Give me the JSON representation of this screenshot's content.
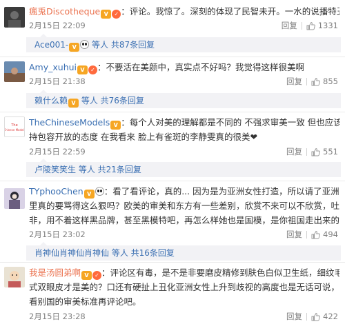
{
  "comments": [
    {
      "user": "瘋兎Discotheque",
      "text": "：评论。我惊了。深刻的体现了民智未开。一水的说播特丑。品品。",
      "lines": [
        "：评论。我惊了。深刻的体现了民智未开。一水的说播特丑。品品。"
      ],
      "time": "2月15日 22:09",
      "reply_label": "回复",
      "likes": "1331",
      "replies": {
        "user": "Ace001-",
        "summary": "等人 共87条回复"
      }
    },
    {
      "user": "Amy_xuhui",
      "lines": [
        "：不要活在美颜中，真实点不好吗？我觉得这样很美啊"
      ],
      "time": "2月15日 21:38",
      "reply_label": "回复",
      "likes": "855",
      "replies": {
        "user": "赖什么赖",
        "summary": "等人 共76条回复"
      }
    },
    {
      "user": "TheChineseModels",
      "lines": [
        "：每个人对美的理解都是不同的 不强求审美一致 但也应该对不同的面孔保",
        "持包容开放的态度 在我看来 脸上有雀斑的李静雯真的很美❤"
      ],
      "time": "2月15日 22:59",
      "reply_label": "回复",
      "likes": "551",
      "replies": {
        "user": "卢陵笑笑生",
        "summary": "等人 共21条回复"
      }
    },
    {
      "user": "TYphooChen",
      "lines": [
        "：看了看评论，真的... 因为是为亚洲女性打造，所以请了亚洲模特。评论",
        "里真的要骂得这么狠吗？欧美的审美和东方有一些差别，欣赏不来可以不欣赏，吐吐槽也无可厚",
        "非，用不着这样黑品牌，甚至黑模特吧，再怎么样她也是国模，是你祖国走出来的模特"
      ],
      "time": "2月15日 23:02",
      "reply_label": "回复",
      "likes": "494",
      "replies": {
        "user": "肖神仙肖神仙肖神仙",
        "summary": "等人 共16条回复"
      }
    },
    {
      "user": "我是汤圆弟啊",
      "lines": [
        "：评论区有毒，是不是非要磨皮精修到肤色白似卫生纸，细纹毛孔统统没有，欧",
        "式双眼皮才是美的？口还有硬扯上丑化亚洲女性上升到歧视的高度也是无话可说，建议多走出去看",
        "看别国的审美标准再评论吧。"
      ],
      "time": "2月15日 23:28",
      "reply_label": "回复",
      "likes": "422"
    }
  ],
  "colors": {
    "orange_name": "#eb7350",
    "link_blue": "#3a6fb2",
    "meta_gray": "#808080",
    "reply_bg": "#f2f2f5"
  },
  "icons": {
    "like": "thumbs-up-icon",
    "vip": "vip-badge-icon",
    "panda": "panda-badge-icon"
  }
}
